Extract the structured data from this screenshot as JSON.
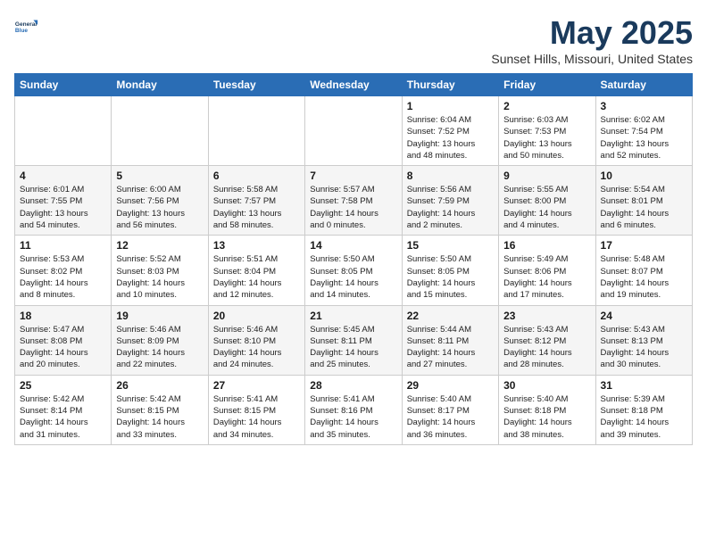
{
  "logo": {
    "line1": "General",
    "line2": "Blue"
  },
  "title": "May 2025",
  "subtitle": "Sunset Hills, Missouri, United States",
  "days_of_week": [
    "Sunday",
    "Monday",
    "Tuesday",
    "Wednesday",
    "Thursday",
    "Friday",
    "Saturday"
  ],
  "weeks": [
    [
      {
        "num": "",
        "info": ""
      },
      {
        "num": "",
        "info": ""
      },
      {
        "num": "",
        "info": ""
      },
      {
        "num": "",
        "info": ""
      },
      {
        "num": "1",
        "info": "Sunrise: 6:04 AM\nSunset: 7:52 PM\nDaylight: 13 hours\nand 48 minutes."
      },
      {
        "num": "2",
        "info": "Sunrise: 6:03 AM\nSunset: 7:53 PM\nDaylight: 13 hours\nand 50 minutes."
      },
      {
        "num": "3",
        "info": "Sunrise: 6:02 AM\nSunset: 7:54 PM\nDaylight: 13 hours\nand 52 minutes."
      }
    ],
    [
      {
        "num": "4",
        "info": "Sunrise: 6:01 AM\nSunset: 7:55 PM\nDaylight: 13 hours\nand 54 minutes."
      },
      {
        "num": "5",
        "info": "Sunrise: 6:00 AM\nSunset: 7:56 PM\nDaylight: 13 hours\nand 56 minutes."
      },
      {
        "num": "6",
        "info": "Sunrise: 5:58 AM\nSunset: 7:57 PM\nDaylight: 13 hours\nand 58 minutes."
      },
      {
        "num": "7",
        "info": "Sunrise: 5:57 AM\nSunset: 7:58 PM\nDaylight: 14 hours\nand 0 minutes."
      },
      {
        "num": "8",
        "info": "Sunrise: 5:56 AM\nSunset: 7:59 PM\nDaylight: 14 hours\nand 2 minutes."
      },
      {
        "num": "9",
        "info": "Sunrise: 5:55 AM\nSunset: 8:00 PM\nDaylight: 14 hours\nand 4 minutes."
      },
      {
        "num": "10",
        "info": "Sunrise: 5:54 AM\nSunset: 8:01 PM\nDaylight: 14 hours\nand 6 minutes."
      }
    ],
    [
      {
        "num": "11",
        "info": "Sunrise: 5:53 AM\nSunset: 8:02 PM\nDaylight: 14 hours\nand 8 minutes."
      },
      {
        "num": "12",
        "info": "Sunrise: 5:52 AM\nSunset: 8:03 PM\nDaylight: 14 hours\nand 10 minutes."
      },
      {
        "num": "13",
        "info": "Sunrise: 5:51 AM\nSunset: 8:04 PM\nDaylight: 14 hours\nand 12 minutes."
      },
      {
        "num": "14",
        "info": "Sunrise: 5:50 AM\nSunset: 8:05 PM\nDaylight: 14 hours\nand 14 minutes."
      },
      {
        "num": "15",
        "info": "Sunrise: 5:50 AM\nSunset: 8:05 PM\nDaylight: 14 hours\nand 15 minutes."
      },
      {
        "num": "16",
        "info": "Sunrise: 5:49 AM\nSunset: 8:06 PM\nDaylight: 14 hours\nand 17 minutes."
      },
      {
        "num": "17",
        "info": "Sunrise: 5:48 AM\nSunset: 8:07 PM\nDaylight: 14 hours\nand 19 minutes."
      }
    ],
    [
      {
        "num": "18",
        "info": "Sunrise: 5:47 AM\nSunset: 8:08 PM\nDaylight: 14 hours\nand 20 minutes."
      },
      {
        "num": "19",
        "info": "Sunrise: 5:46 AM\nSunset: 8:09 PM\nDaylight: 14 hours\nand 22 minutes."
      },
      {
        "num": "20",
        "info": "Sunrise: 5:46 AM\nSunset: 8:10 PM\nDaylight: 14 hours\nand 24 minutes."
      },
      {
        "num": "21",
        "info": "Sunrise: 5:45 AM\nSunset: 8:11 PM\nDaylight: 14 hours\nand 25 minutes."
      },
      {
        "num": "22",
        "info": "Sunrise: 5:44 AM\nSunset: 8:11 PM\nDaylight: 14 hours\nand 27 minutes."
      },
      {
        "num": "23",
        "info": "Sunrise: 5:43 AM\nSunset: 8:12 PM\nDaylight: 14 hours\nand 28 minutes."
      },
      {
        "num": "24",
        "info": "Sunrise: 5:43 AM\nSunset: 8:13 PM\nDaylight: 14 hours\nand 30 minutes."
      }
    ],
    [
      {
        "num": "25",
        "info": "Sunrise: 5:42 AM\nSunset: 8:14 PM\nDaylight: 14 hours\nand 31 minutes."
      },
      {
        "num": "26",
        "info": "Sunrise: 5:42 AM\nSunset: 8:15 PM\nDaylight: 14 hours\nand 33 minutes."
      },
      {
        "num": "27",
        "info": "Sunrise: 5:41 AM\nSunset: 8:15 PM\nDaylight: 14 hours\nand 34 minutes."
      },
      {
        "num": "28",
        "info": "Sunrise: 5:41 AM\nSunset: 8:16 PM\nDaylight: 14 hours\nand 35 minutes."
      },
      {
        "num": "29",
        "info": "Sunrise: 5:40 AM\nSunset: 8:17 PM\nDaylight: 14 hours\nand 36 minutes."
      },
      {
        "num": "30",
        "info": "Sunrise: 5:40 AM\nSunset: 8:18 PM\nDaylight: 14 hours\nand 38 minutes."
      },
      {
        "num": "31",
        "info": "Sunrise: 5:39 AM\nSunset: 8:18 PM\nDaylight: 14 hours\nand 39 minutes."
      }
    ]
  ]
}
